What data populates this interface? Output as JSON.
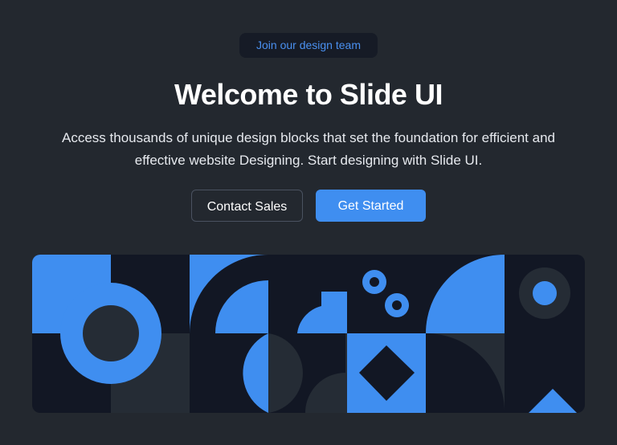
{
  "hero": {
    "badge": "Join our design team",
    "title": "Welcome to Slide UI",
    "subtitle": "Access thousands of unique design blocks that set the foundation for efficient and effective website Designing. Start designing with Slide UI."
  },
  "actions": {
    "secondary_label": "Contact Sales",
    "primary_label": "Get Started"
  },
  "colors": {
    "background": "#23282f",
    "panel_dark": "#121724",
    "panel_mid": "#252c35",
    "accent": "#3f8ef0",
    "text": "#ffffff"
  }
}
